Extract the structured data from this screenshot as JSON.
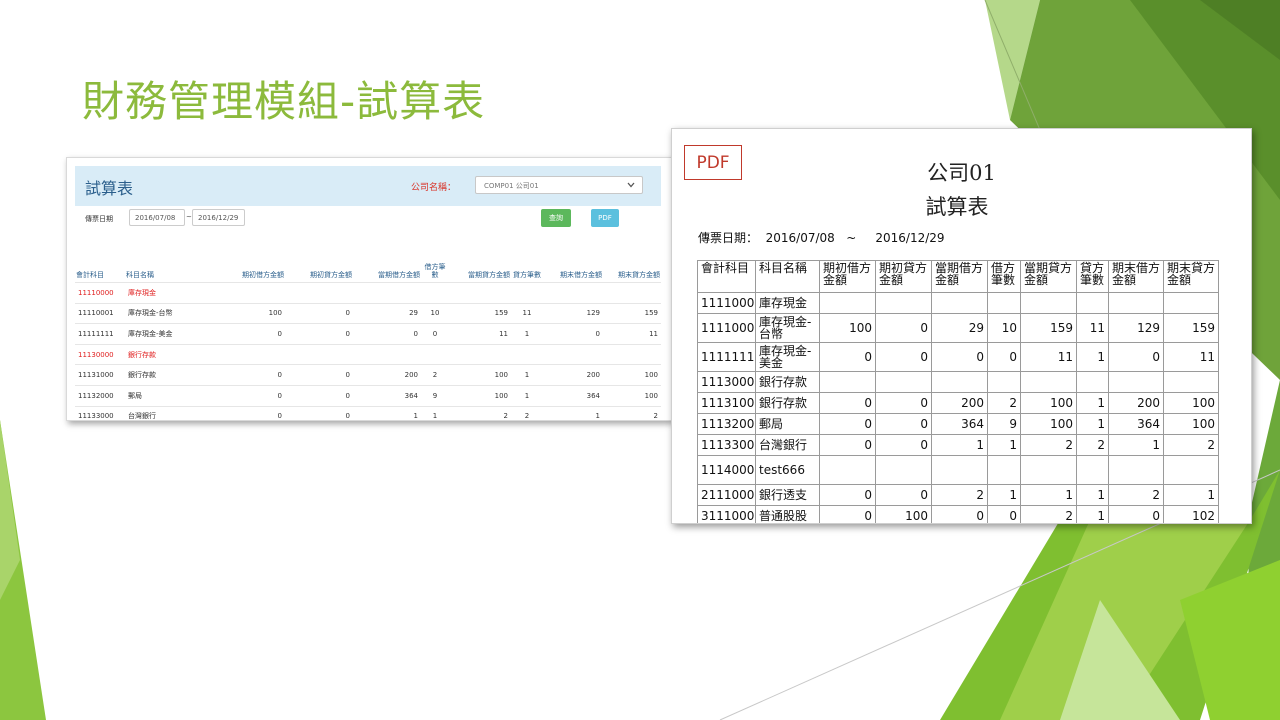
{
  "slide": {
    "title": "財務管理模組-試算表"
  },
  "colors": {
    "accent_green": "#8cba3c",
    "web_header_bg": "#d9ecf7",
    "web_title": "#2b5f8c",
    "pdf_badge_red": "#c0392b"
  },
  "web": {
    "title": "試算表",
    "company_label": "公司名稱：",
    "company_value": "COMP01 公司01",
    "date_label": "傳票日期",
    "date_from": "2016/07/08",
    "date_sep": "~",
    "date_to": "2016/12/29",
    "query_button": "查詢",
    "pdf_button": "PDF",
    "headers": [
      "會計科目",
      "科目名稱",
      "期初借方金額",
      "期初貸方金額",
      "當期借方金額",
      "借方筆數",
      "當期貸方金額",
      "貸方筆數",
      "期末借方金額",
      "期末貸方金額"
    ],
    "rows": [
      {
        "cells": [
          "11110000",
          "庫存現金",
          "",
          "",
          "",
          "",
          "",
          "",
          "",
          ""
        ]
      },
      {
        "cells": [
          "11110001",
          "庫存現金-台幣",
          "100",
          "0",
          "29",
          "10",
          "159",
          "11",
          "129",
          "159"
        ]
      },
      {
        "cells": [
          "11111111",
          "庫存現金-美金",
          "0",
          "0",
          "0",
          "0",
          "11",
          "1",
          "0",
          "11"
        ]
      },
      {
        "cells": [
          "11130000",
          "銀行存款",
          "",
          "",
          "",
          "",
          "",
          "",
          "",
          ""
        ]
      },
      {
        "cells": [
          "11131000",
          "銀行存款",
          "0",
          "0",
          "200",
          "2",
          "100",
          "1",
          "200",
          "100"
        ]
      },
      {
        "cells": [
          "11132000",
          "郵局",
          "0",
          "0",
          "364",
          "9",
          "100",
          "1",
          "364",
          "100"
        ]
      },
      {
        "cells": [
          "11133000",
          "台灣銀行",
          "0",
          "0",
          "1",
          "1",
          "2",
          "2",
          "1",
          "2"
        ]
      }
    ]
  },
  "pdf": {
    "badge": "PDF",
    "company": "公司01",
    "title": "試算表",
    "date_line": "傳票日期：  2016/07/08   ~     2016/12/29",
    "headers": [
      "會計科目",
      "科目名稱",
      "期初借方金額",
      "期初貸方金額",
      "當期借方金額",
      "借方筆數",
      "當期貸方金額",
      "貸方筆數",
      "期末借方金額",
      "期末貸方金額"
    ],
    "rows": [
      {
        "cells": [
          "11110000",
          "庫存現金",
          "",
          "",
          "",
          "",
          "",
          "",
          "",
          ""
        ]
      },
      {
        "cells": [
          "11110001",
          "庫存現金-台幣",
          "100",
          "0",
          "29",
          "10",
          "159",
          "11",
          "129",
          "159"
        ]
      },
      {
        "cells": [
          "11111111",
          "庫存現金-美金",
          "0",
          "0",
          "0",
          "0",
          "11",
          "1",
          "0",
          "11"
        ]
      },
      {
        "cells": [
          "11130000",
          "銀行存款",
          "",
          "",
          "",
          "",
          "",
          "",
          "",
          ""
        ]
      },
      {
        "cells": [
          "11131000",
          "銀行存款",
          "0",
          "0",
          "200",
          "2",
          "100",
          "1",
          "200",
          "100"
        ]
      },
      {
        "cells": [
          "11132000",
          "郵局",
          "0",
          "0",
          "364",
          "9",
          "100",
          "1",
          "364",
          "100"
        ]
      },
      {
        "cells": [
          "11133000",
          "台灣銀行",
          "0",
          "0",
          "1",
          "1",
          "2",
          "2",
          "1",
          "2"
        ]
      },
      {
        "cells": [
          "11140000",
          "test666",
          "",
          "",
          "",
          "",
          "",
          "",
          "",
          ""
        ]
      },
      {
        "cells": [
          "21110000",
          "銀行透支",
          "0",
          "0",
          "2",
          "1",
          "1",
          "1",
          "2",
          "1"
        ]
      },
      {
        "cells": [
          "31110000",
          "普通股股",
          "0",
          "100",
          "0",
          "0",
          "2",
          "1",
          "0",
          "102"
        ]
      }
    ]
  }
}
